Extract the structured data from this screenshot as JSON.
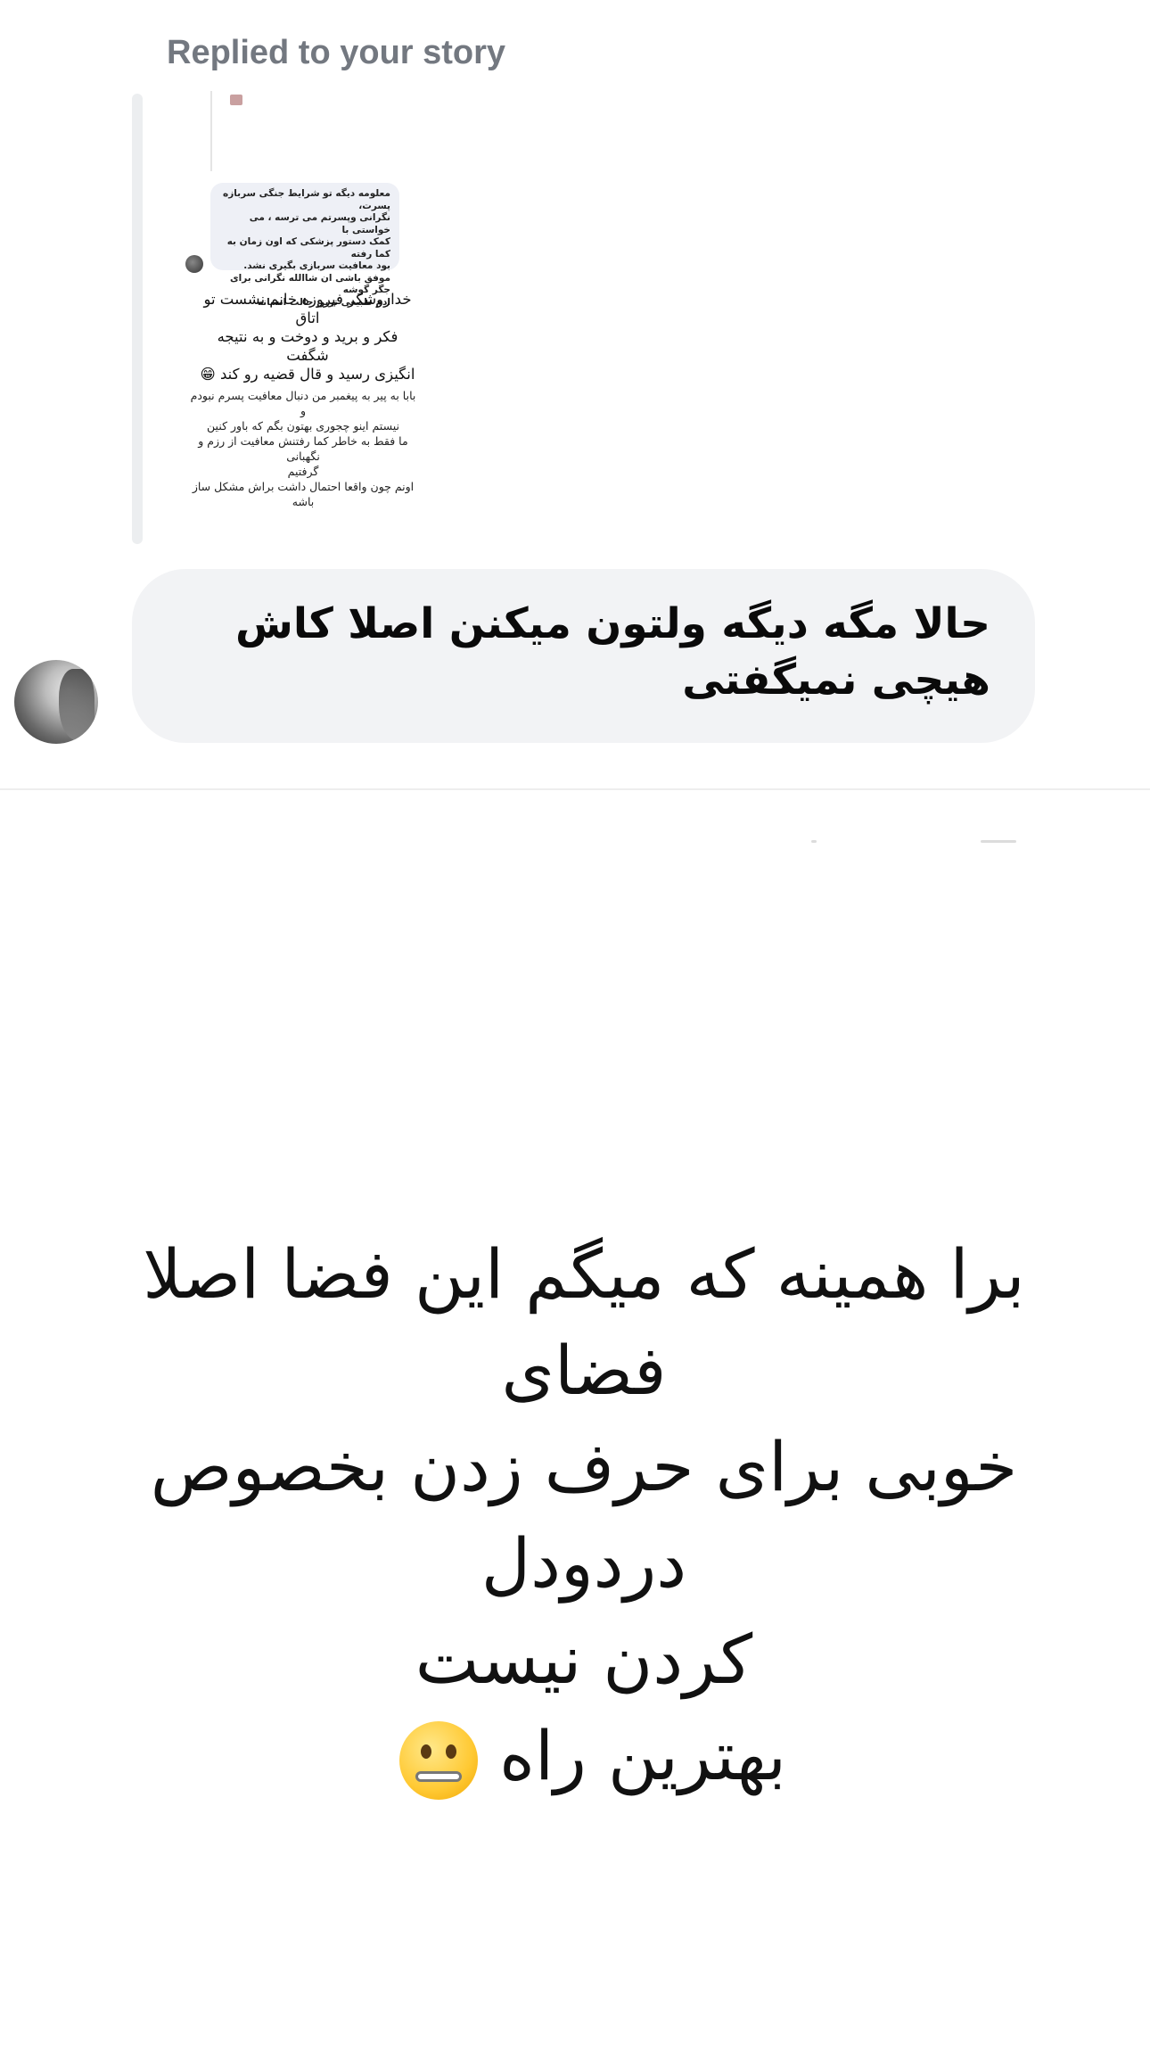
{
  "story_reply": {
    "label": "Replied to your story",
    "preview": {
      "bubble_text": "معلومه دیگه تو شرایط جنگی سربازه پسرت،\nنگرانی وپسرتم می ترسه ، می خواستی با\nکمک دستور پزشکی که اون زمان به کما رفته\nبود معافیت سربازی بگیری نشد.\nموفق باشی ان شاالله نگرانی برای جگر گوشه\nادم طبیعی ترین حالت انسانه",
      "text_1": "خداروشکر فیروزه خانم نشست تو اتاق\nفکر و برید و دوخت و به نتیجه شگفت\nانگیزی رسید و قال قضیه رو کند 😁",
      "text_2": "بابا به پیر به پیغمبر من دنبال معافیت پسرم نبودم و\nنیستم اینو چجوری بهتون بگم که باور کنین\nما فقط به خاطر کما رفتنش معافیت از رزم و نگهبانی\nگرفتیم\nاونم چون واقعا احتمال داشت براش مشکل ساز باشه\nتا الان حتی به معافیت کامل فکر نکردم چه برسه که\nاقدام کنم 😔"
    }
  },
  "message": {
    "text": "حالا مگه دیگه ولتون میکنن اصلا کاش هیچی نمیگفتی"
  },
  "post": {
    "lines": [
      "برا همینه که میگم این فضا اصلا فضای",
      "خوبی برای حرف زدن بخصوص دردودل",
      "کردن نیست",
      "بهترین راه"
    ],
    "emoji": "zipper-mouth-face"
  },
  "colors": {
    "bubble_bg": "#f2f3f5",
    "label": "#737880",
    "divider": "#eeeeee"
  }
}
